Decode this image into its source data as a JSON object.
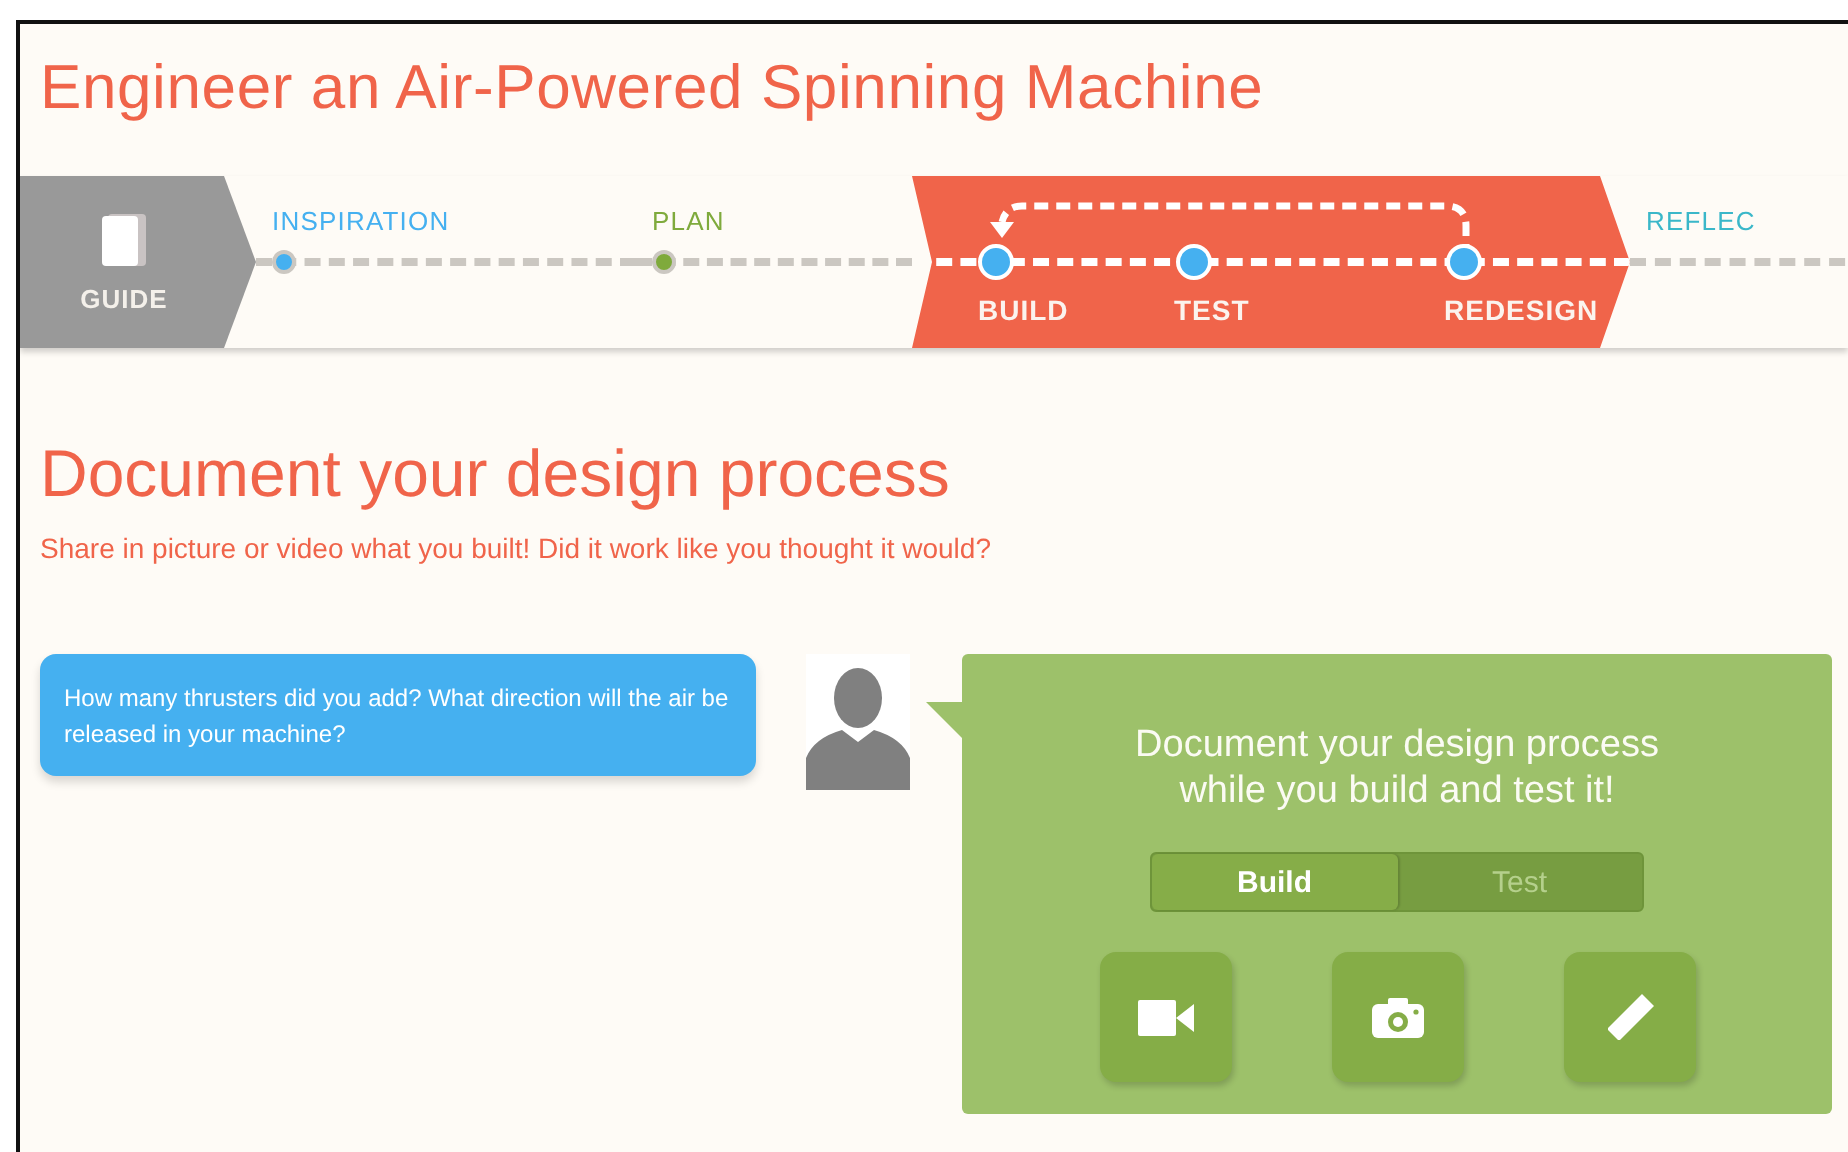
{
  "title": "Engineer an Air-Powered Spinning Machine",
  "guide": {
    "label": "GUIDE"
  },
  "stages": [
    {
      "kind": "phase",
      "label": "INSPIRATION",
      "color": "#45b0f0",
      "selected": false
    },
    {
      "kind": "phase",
      "label": "PLAN",
      "color": "#7faa3c",
      "selected": false
    },
    {
      "kind": "cycle",
      "selected": true,
      "steps": [
        {
          "label": "BUILD"
        },
        {
          "label": "TEST"
        },
        {
          "label": "REDESIGN"
        }
      ]
    },
    {
      "kind": "phase",
      "label": "REFLEC",
      "color": "#3ab7c9",
      "selected": false
    }
  ],
  "heading": "Document your design process",
  "subheading": "Share in picture or video what you built! Did it work like you thought it would?",
  "prompt": "How many thrusters did you add? What direction will the air be released in your machine?",
  "panel": {
    "message": "Document your design process while you build and test it!",
    "tabs": [
      {
        "label": "Build",
        "selected": true
      },
      {
        "label": "Test",
        "selected": false
      }
    ],
    "actions": [
      {
        "kind": "video"
      },
      {
        "kind": "camera"
      },
      {
        "kind": "note"
      }
    ]
  }
}
